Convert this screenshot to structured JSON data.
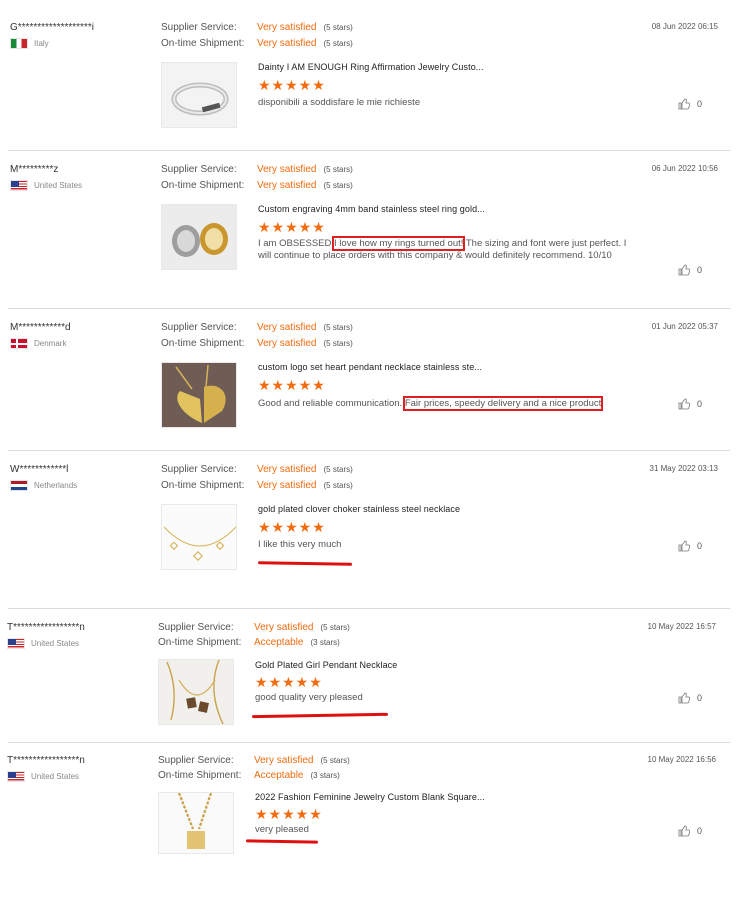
{
  "labels": {
    "supplier_service": "Supplier Service:",
    "ontime_shipment": "On-time Shipment:"
  },
  "reviews": [
    {
      "buyer": "G*******************i",
      "country": "Italy",
      "flag": "italy-flag-icon",
      "date": "08 Jun 2022 06:15",
      "supplier_service": {
        "value": "Very satisfied",
        "stars": "(5 stars)"
      },
      "ontime_shipment": {
        "value": "Very satisfied",
        "stars": "(5 stars)"
      },
      "product_title": "Dainty I AM ENOUGH Ring Affirmation Jewelry Custo...",
      "rating": "★★★★★",
      "comment": "disponibili a soddisfare le mie richieste",
      "likes": "0"
    },
    {
      "buyer": "M*********z",
      "country": "United States",
      "flag": "usa-flag-icon",
      "date": "06 Jun 2022 10:56",
      "supplier_service": {
        "value": "Very satisfied",
        "stars": "(5 stars)"
      },
      "ontime_shipment": {
        "value": "Very satisfied",
        "stars": "(5 stars)"
      },
      "product_title": "Custom engraving 4mm band stainless steel ring gold...",
      "rating": "★★★★★",
      "comment_pre": "I am OBSESSED ",
      "comment_hl": "I love how my rings turned out!",
      "comment_post": " The sizing and font were just perfect. I will continue to place orders with this company & would definitely recommend. 10/10",
      "likes": "0"
    },
    {
      "buyer": "M************d",
      "country": "Denmark",
      "flag": "denmark-flag-icon",
      "date": "01 Jun 2022 05:37",
      "supplier_service": {
        "value": "Very satisfied",
        "stars": "(5 stars)"
      },
      "ontime_shipment": {
        "value": "Very satisfied",
        "stars": "(5 stars)"
      },
      "product_title": "custom logo set heart pendant necklace stainless ste...",
      "rating": "★★★★★",
      "comment_pre": "Good and reliable communication. ",
      "comment_hl": "Fair prices, speedy delivery and a nice product",
      "likes": "0"
    },
    {
      "buyer": "W************l",
      "country": "Netherlands",
      "flag": "netherlands-flag-icon",
      "date": "31 May 2022 03:13",
      "supplier_service": {
        "value": "Very satisfied",
        "stars": "(5 stars)"
      },
      "ontime_shipment": {
        "value": "Very satisfied",
        "stars": "(5 stars)"
      },
      "product_title": "gold plated clover choker stainless steel necklace",
      "rating": "★★★★★",
      "comment": "I like this very much",
      "likes": "0"
    },
    {
      "buyer": "T*****************n",
      "country": "United States",
      "flag": "usa-flag-icon",
      "date": "10 May 2022 16:57",
      "supplier_service": {
        "value": "Very satisfied",
        "stars": "(5 stars)"
      },
      "ontime_shipment": {
        "value": "Acceptable",
        "stars": "(3 stars)"
      },
      "product_title": "Gold Plated Girl Pendant Necklace",
      "rating": "★★★★★",
      "comment": "good quality very pleased",
      "likes": "0"
    },
    {
      "buyer": "T*****************n",
      "country": "United States",
      "flag": "usa-flag-icon",
      "date": "10 May 2022 16:56",
      "supplier_service": {
        "value": "Very satisfied",
        "stars": "(5 stars)"
      },
      "ontime_shipment": {
        "value": "Acceptable",
        "stars": "(3 stars)"
      },
      "product_title": "2022 Fashion Feminine Jewelry Custom Blank Square...",
      "rating": "★★★★★",
      "comment": "very pleased",
      "likes": "0"
    }
  ],
  "colors": {
    "accent": "#f26b0f",
    "highlight": "#e02020"
  }
}
